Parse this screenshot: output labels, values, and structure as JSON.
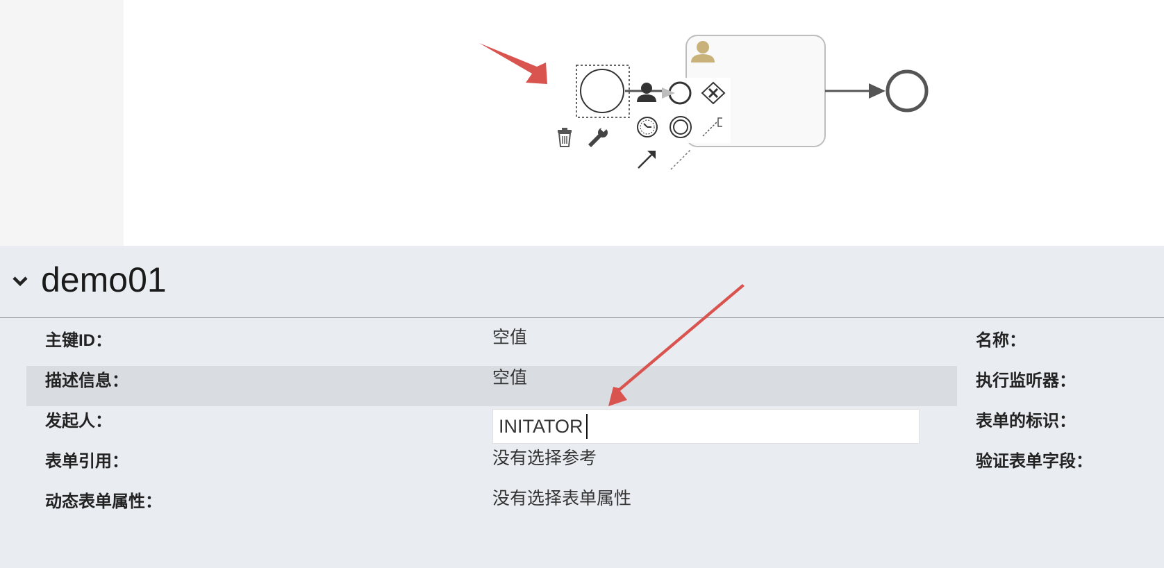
{
  "process": {
    "name": "demo01"
  },
  "properties": {
    "id_label": "主键ID：",
    "id_value": "空值",
    "description_label": "描述信息：",
    "description_value": "空值",
    "initiator_label": "发起人：",
    "initiator_value": "INITATOR",
    "form_reference_label": "表单引用：",
    "form_reference_value": "没有选择参考",
    "dynamic_form_label": "动态表单属性：",
    "dynamic_form_value": "没有选择表单属性",
    "name_label": "名称：",
    "execution_listener_label": "执行监听器：",
    "form_key_label": "表单的标识：",
    "validate_form_fields_label": "验证表单字段："
  },
  "icons": {
    "collapse": "chevron-down-icon",
    "delete": "trash-icon",
    "properties": "wrench-icon",
    "user": "user-icon",
    "annotation_color": "#d9534f",
    "user_icon_color": "#c8b27a"
  }
}
